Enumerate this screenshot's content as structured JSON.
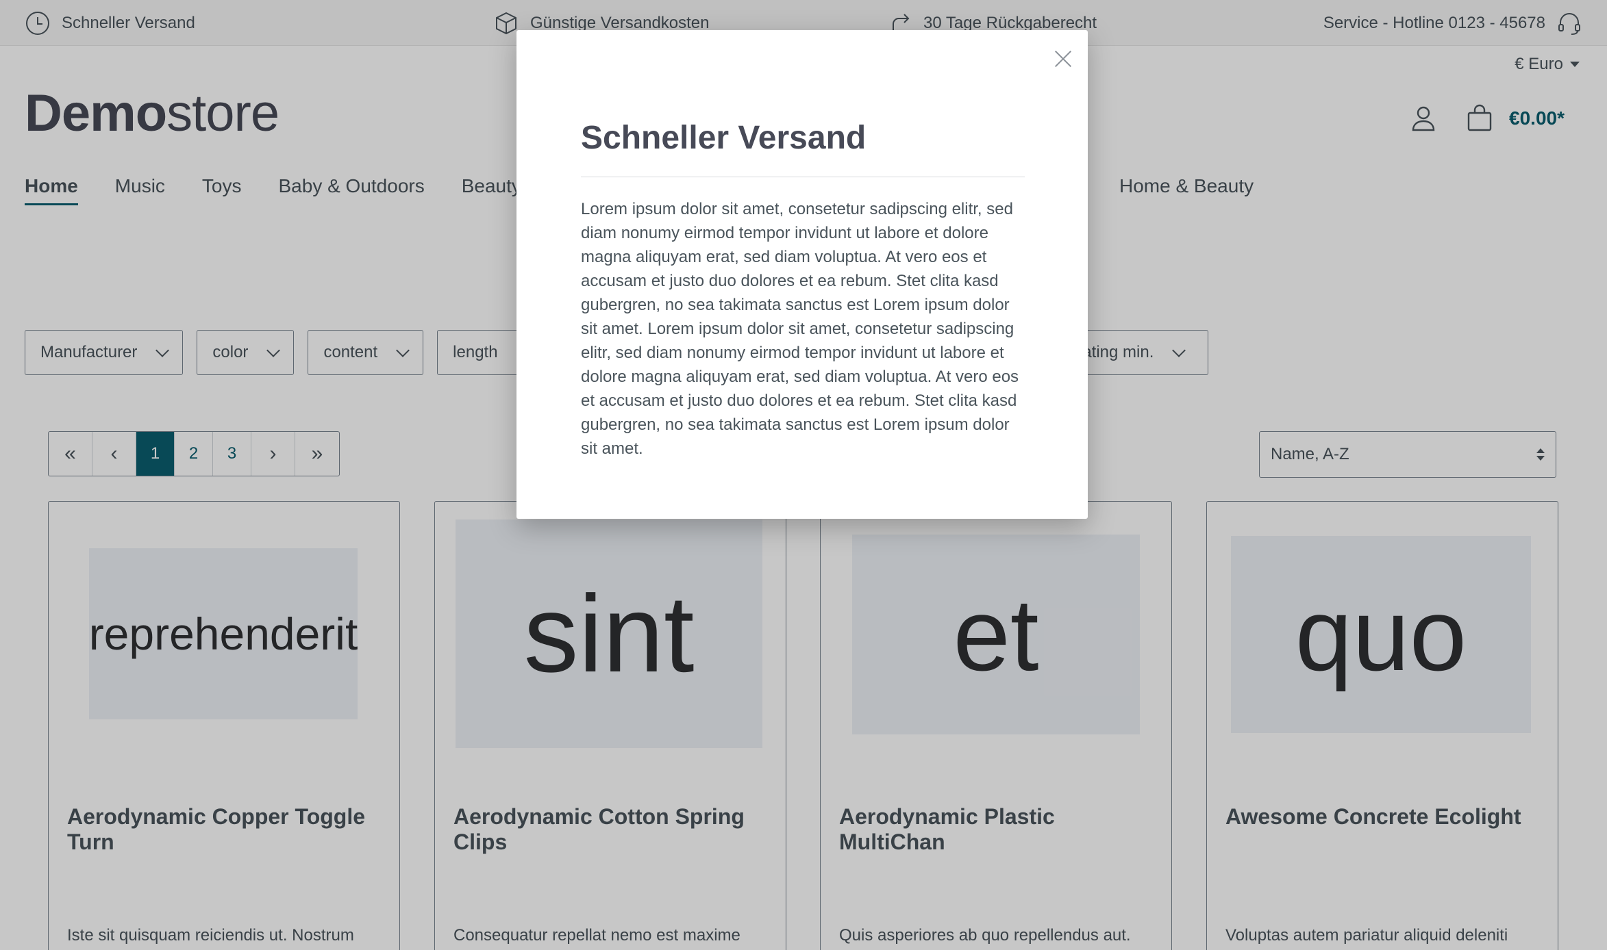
{
  "topbar": {
    "usps": [
      {
        "label": "Schneller Versand",
        "icon": "clock-icon"
      },
      {
        "label": "Günstige Versandkosten",
        "icon": "box-icon"
      },
      {
        "label": "30 Tage Rückgaberecht",
        "icon": "return-arrow-icon"
      }
    ],
    "hotline": "Service - Hotline 0123 - 45678",
    "hotline_icon": "headset-icon"
  },
  "header": {
    "currency": "€ Euro",
    "logo_bold": "Demo",
    "logo_light": "store",
    "cart_total": "€0.00*"
  },
  "nav": {
    "items": [
      "Home",
      "Music",
      "Toys",
      "Baby & Outdoors",
      "Beauty"
    ],
    "right_item": "Home & Beauty",
    "active": "Home"
  },
  "filters": {
    "items": [
      "Manufacturer",
      "color",
      "content",
      "length"
    ],
    "rating_label": "Rating min."
  },
  "pagination": {
    "first": "«",
    "prev": "‹",
    "pages": [
      "1",
      "2",
      "3"
    ],
    "current": "1",
    "next": "›",
    "last": "»"
  },
  "sort": {
    "selected": "Name, A-Z"
  },
  "products": [
    {
      "image_text": "reprehenderit",
      "name": "Aerodynamic Copper Toggle Turn",
      "desc": "Iste sit quisquam reiciendis ut. Nostrum"
    },
    {
      "image_text": "sint",
      "name": "Aerodynamic Cotton Spring Clips",
      "desc": "Consequatur repellat nemo est maxime"
    },
    {
      "image_text": "et",
      "name": "Aerodynamic Plastic MultiChan",
      "desc": "Quis asperiores ab quo repellendus aut."
    },
    {
      "image_text": "quo",
      "name": "Awesome Concrete Ecolight",
      "desc": "Voluptas autem pariatur aliquid deleniti"
    }
  ],
  "modal": {
    "title": "Schneller Versand",
    "body": "Lorem ipsum dolor sit amet, consetetur sadipscing elitr, sed diam nonumy eirmod tempor invidunt ut labore et dolore magna aliquyam erat, sed diam voluptua. At vero eos et accusam et justo duo dolores et ea rebum. Stet clita kasd gubergren, no sea takimata sanctus est Lorem ipsum dolor sit amet. Lorem ipsum dolor sit amet, consetetur sadipscing elitr, sed diam nonumy eirmod tempor invidunt ut labore et dolore magna aliquyam erat, sed diam voluptua. At vero eos et accusam et justo duo dolores et ea rebum. Stet clita kasd gubergren, no sea takimata sanctus est Lorem ipsum dolor sit amet."
  },
  "colors": {
    "accent": "#0b5e6f",
    "text": "#4a545b",
    "image_placeholder": "#eef1f6"
  }
}
